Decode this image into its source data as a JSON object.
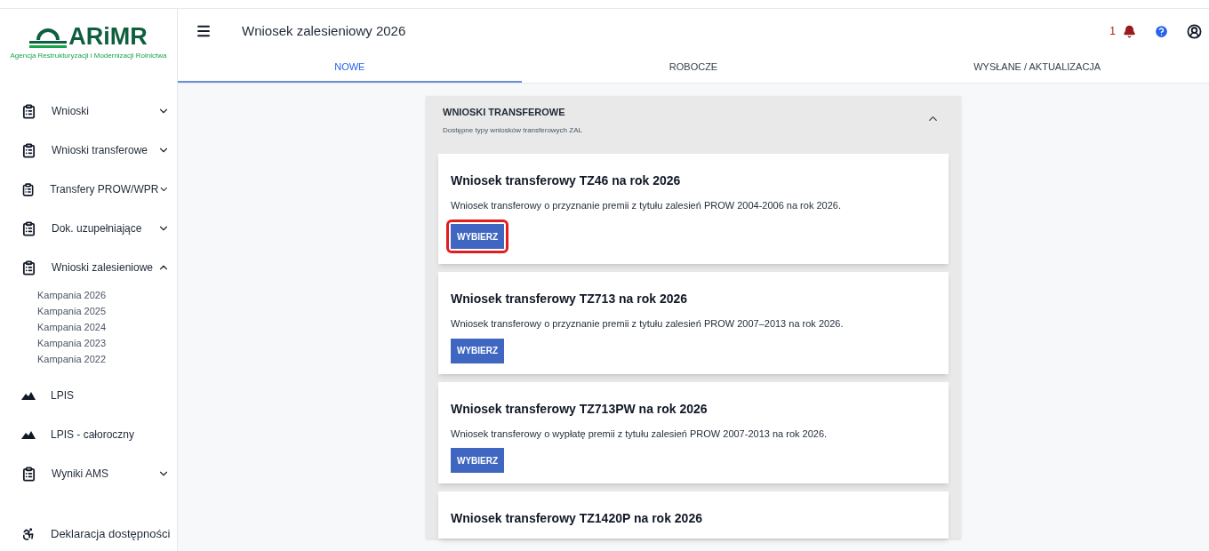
{
  "logo": {
    "name": "ARiMR",
    "subtitle": "Agencja Restrukturyzacji i Modernizacji Rolnictwa"
  },
  "sidebar": {
    "items": [
      {
        "label": "Wnioski",
        "kind": "clipboard",
        "expanded": false
      },
      {
        "label": "Wnioski transferowe",
        "kind": "clipboard",
        "expanded": false
      },
      {
        "label": "Transfery PROW/WPR",
        "kind": "clipboard",
        "expanded": false
      },
      {
        "label": "Dok. uzupełniające",
        "kind": "clipboard",
        "expanded": false
      },
      {
        "label": "Wnioski zalesieniowe",
        "kind": "clipboard",
        "expanded": true,
        "children": [
          "Kampania 2026",
          "Kampania 2025",
          "Kampania 2024",
          "Kampania 2023",
          "Kampania 2022"
        ]
      },
      {
        "label": "LPIS",
        "kind": "mountain"
      },
      {
        "label": "LPIS - całoroczny",
        "kind": "mountain"
      },
      {
        "label": "Wyniki AMS",
        "kind": "clipboard",
        "expanded": false
      }
    ],
    "footer": {
      "label": "Deklaracja dostępności"
    }
  },
  "header": {
    "title": "Wniosek zalesieniowy 2026",
    "notification_count": "1"
  },
  "tabs": [
    {
      "label": "NOWE",
      "selected": true
    },
    {
      "label": "ROBOCZE",
      "selected": false
    },
    {
      "label": "WYSŁANE / AKTUALIZACJA",
      "selected": false
    }
  ],
  "panel": {
    "title": "WNIOSKI TRANSFEROWE",
    "subtitle": "Dostępne typy wniosków transferowych ZAL",
    "expanded": true,
    "cards": [
      {
        "title": "Wniosek transferowy TZ46 na rok 2026",
        "description": "Wniosek transferowy o przyznanie premii z tytułu zalesień PROW 2004-2006 na rok 2026.",
        "button": "WYBIERZ",
        "highlighted": true
      },
      {
        "title": "Wniosek transferowy TZ713 na rok 2026",
        "description": "Wniosek transferowy o przyznanie premii z tytułu zalesień PROW 2007–2013 na rok 2026.",
        "button": "WYBIERZ",
        "highlighted": false
      },
      {
        "title": "Wniosek transferowy TZ713PW na rok 2026",
        "description": "Wniosek transferowy o wypłatę premii z tytułu zalesień PROW 2007-2013 na rok 2026.",
        "button": "WYBIERZ",
        "highlighted": false
      },
      {
        "title": "Wniosek transferowy TZ1420P na rok 2026"
      }
    ]
  }
}
